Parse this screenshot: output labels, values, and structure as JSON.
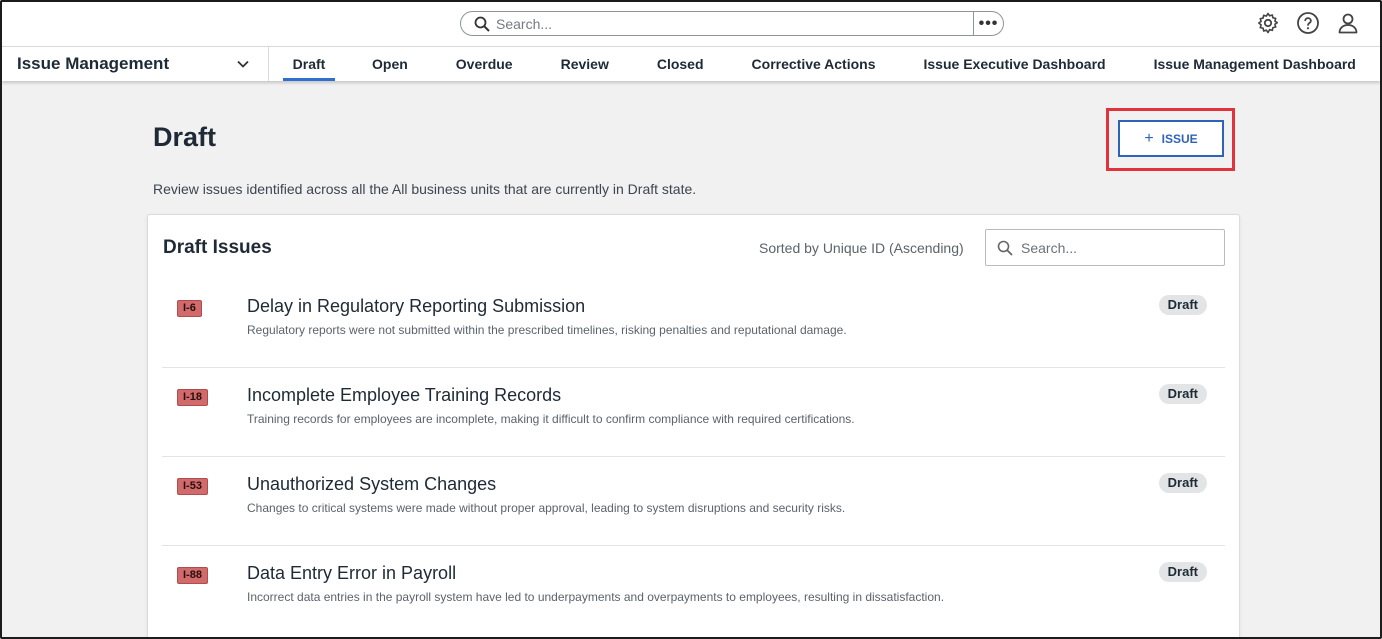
{
  "topbar": {
    "search_placeholder": "Search...",
    "more_label": "•••",
    "icons": [
      "gear-icon",
      "help-icon",
      "user-icon"
    ]
  },
  "nav": {
    "app_title": "Issue Management",
    "tabs": [
      {
        "label": "Draft",
        "active": true
      },
      {
        "label": "Open",
        "active": false
      },
      {
        "label": "Overdue",
        "active": false
      },
      {
        "label": "Review",
        "active": false
      },
      {
        "label": "Closed",
        "active": false
      },
      {
        "label": "Corrective Actions",
        "active": false
      },
      {
        "label": "Issue Executive Dashboard",
        "active": false
      },
      {
        "label": "Issue Management Dashboard",
        "active": false
      }
    ]
  },
  "page": {
    "title": "Draft",
    "description": "Review issues identified across all the All business units that are currently in Draft state.",
    "add_button": {
      "plus": "+",
      "label": "ISSUE"
    }
  },
  "card": {
    "title": "Draft Issues",
    "sort_text": "Sorted by Unique ID (Ascending)",
    "search_placeholder": "Search...",
    "items": [
      {
        "id": "I-6",
        "title": "Delay in Regulatory Reporting Submission",
        "description": "Regulatory reports were not submitted within the prescribed timelines, risking penalties and reputational damage.",
        "status": "Draft"
      },
      {
        "id": "I-18",
        "title": "Incomplete Employee Training Records",
        "description": "Training records for employees are incomplete, making it difficult to confirm compliance with required certifications.",
        "status": "Draft"
      },
      {
        "id": "I-53",
        "title": "Unauthorized System Changes",
        "description": "Changes to critical systems were made without proper approval, leading to system disruptions and security risks.",
        "status": "Draft"
      },
      {
        "id": "I-88",
        "title": "Data Entry Error in Payroll",
        "description": "Incorrect data entries in the payroll system have led to underpayments and overpayments to employees, resulting in dissatisfaction.",
        "status": "Draft"
      }
    ]
  },
  "colors": {
    "accent": "#2e63b8",
    "tab_underline": "#2f6fd0",
    "highlight": "#e0333b",
    "id_badge": "#d16a6a"
  }
}
